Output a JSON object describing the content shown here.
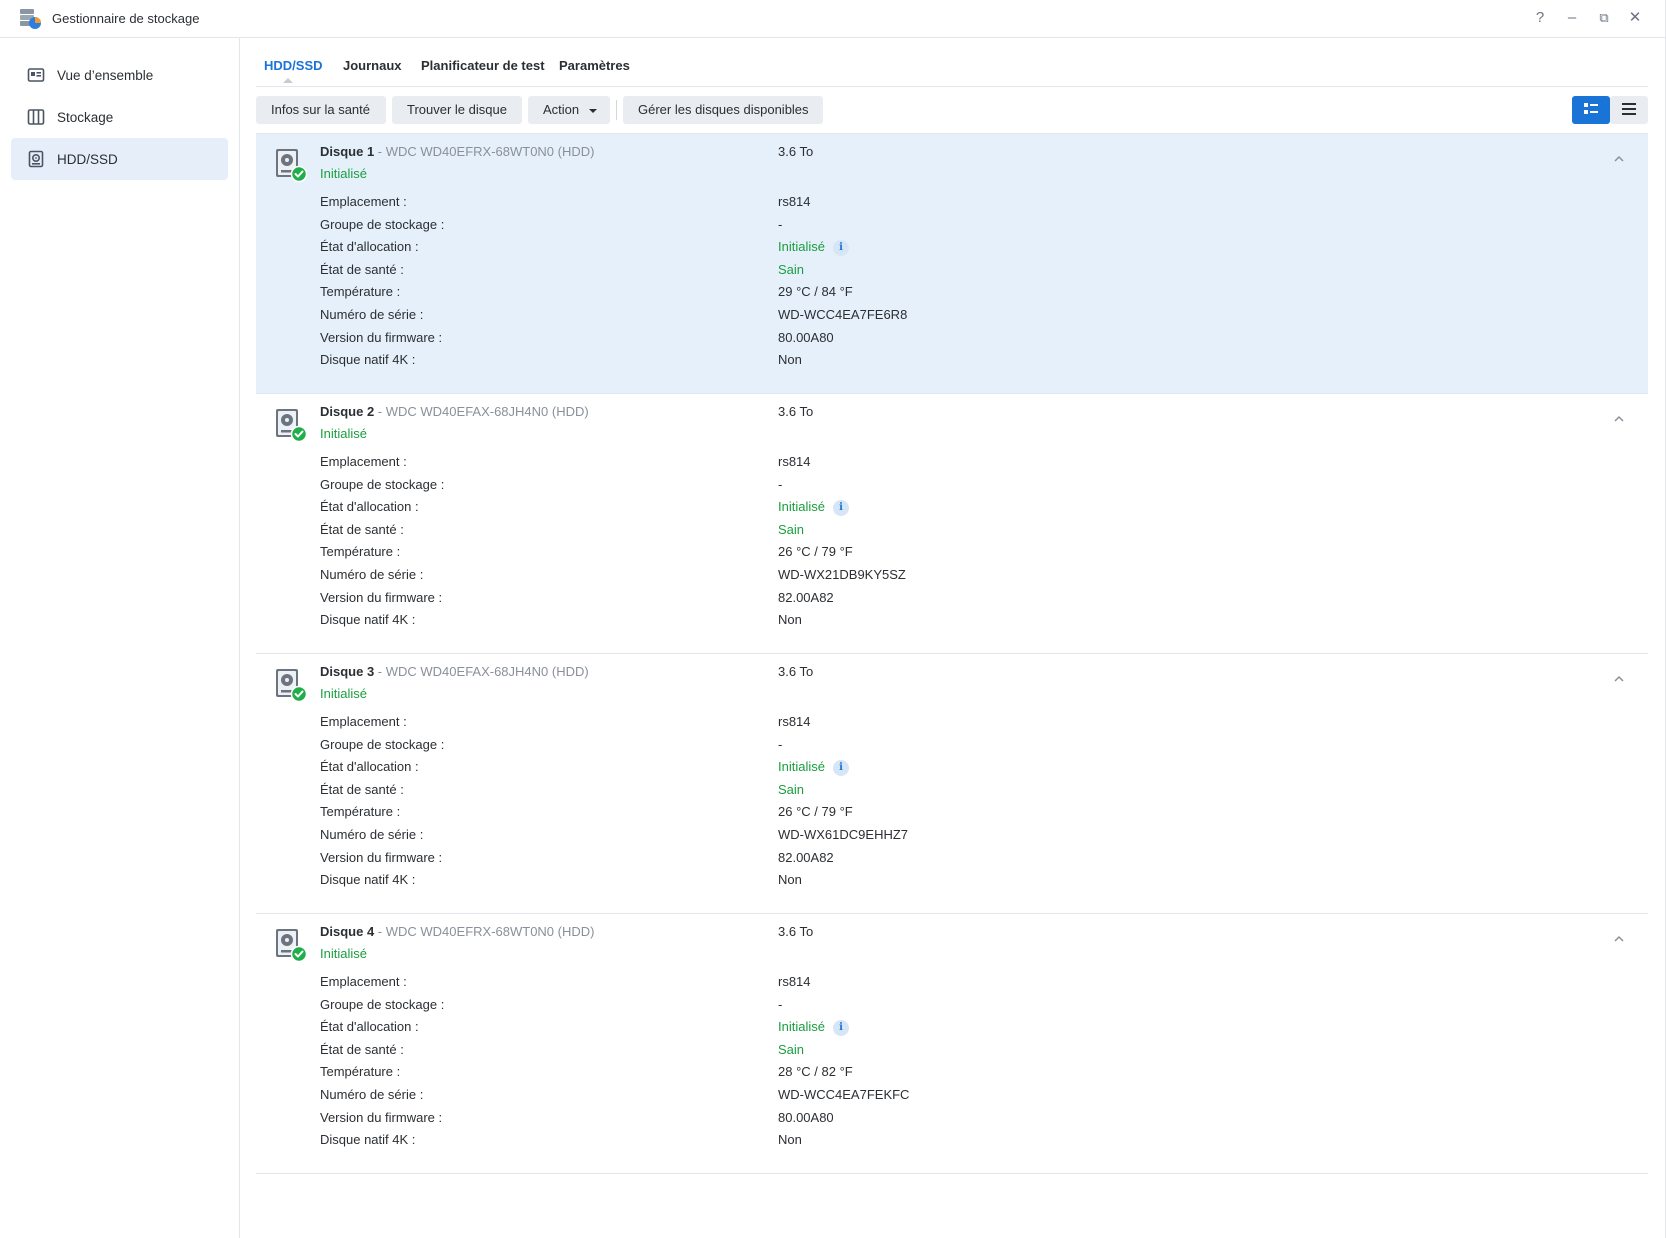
{
  "window": {
    "title": "Gestionnaire de stockage",
    "controls": {
      "help": "?",
      "minimize": "–",
      "restore": "⧉",
      "close": "✕"
    }
  },
  "sidebar": {
    "items": [
      {
        "label": "Vue d’ensemble",
        "icon": "overview-icon",
        "active": false
      },
      {
        "label": "Stockage",
        "icon": "storage-icon",
        "active": false
      },
      {
        "label": "HDD/SSD",
        "icon": "hdd-icon",
        "active": true
      }
    ]
  },
  "tabs": [
    {
      "label": "HDD/SSD",
      "active": true
    },
    {
      "label": "Journaux",
      "active": false
    },
    {
      "label": "Planificateur de test",
      "active": false
    },
    {
      "label": "Paramètres",
      "active": false
    }
  ],
  "toolbar": {
    "health_info": "Infos sur la santé",
    "find_disk": "Trouver le disque",
    "action": "Action",
    "manage_disks": "Gérer les disques disponibles",
    "view_mode": "detail-list"
  },
  "field_labels": {
    "location": "Emplacement :",
    "storage_pool": "Groupe de stockage :",
    "allocation": "État d'allocation :",
    "health": "État de santé :",
    "temperature": "Température :",
    "serial": "Numéro de série :",
    "firmware": "Version du firmware :",
    "native_4k": "Disque natif 4K :"
  },
  "disks": [
    {
      "name": "Disque 1",
      "model": " - WDC WD40EFRX-68WT0N0 (HDD)",
      "status": "Initialisé",
      "size": "3.6 To",
      "location": "rs814",
      "storage_pool": "-",
      "allocation": "Initialisé",
      "health": "Sain",
      "temperature": "29 °C / 84 °F",
      "serial": "WD-WCC4EA7FE6R8",
      "firmware": "80.00A80",
      "native_4k": "Non",
      "selected": true
    },
    {
      "name": "Disque 2",
      "model": " - WDC WD40EFAX-68JH4N0 (HDD)",
      "status": "Initialisé",
      "size": "3.6 To",
      "location": "rs814",
      "storage_pool": "-",
      "allocation": "Initialisé",
      "health": "Sain",
      "temperature": "26 °C / 79 °F",
      "serial": "WD-WX21DB9KY5SZ",
      "firmware": "82.00A82",
      "native_4k": "Non",
      "selected": false
    },
    {
      "name": "Disque 3",
      "model": " - WDC WD40EFAX-68JH4N0 (HDD)",
      "status": "Initialisé",
      "size": "3.6 To",
      "location": "rs814",
      "storage_pool": "-",
      "allocation": "Initialisé",
      "health": "Sain",
      "temperature": "26 °C / 79 °F",
      "serial": "WD-WX61DC9EHHZ7",
      "firmware": "82.00A82",
      "native_4k": "Non",
      "selected": false
    },
    {
      "name": "Disque 4",
      "model": " - WDC WD40EFRX-68WT0N0 (HDD)",
      "status": "Initialisé",
      "size": "3.6 To",
      "location": "rs814",
      "storage_pool": "-",
      "allocation": "Initialisé",
      "health": "Sain",
      "temperature": "28 °C / 82 °F",
      "serial": "WD-WCC4EA7FEKFC",
      "firmware": "80.00A80",
      "native_4k": "Non",
      "selected": false
    }
  ],
  "colors": {
    "accent": "#1a74d8",
    "status_ok": "#1a9e3f",
    "selected_row": "#e6f0fb"
  }
}
